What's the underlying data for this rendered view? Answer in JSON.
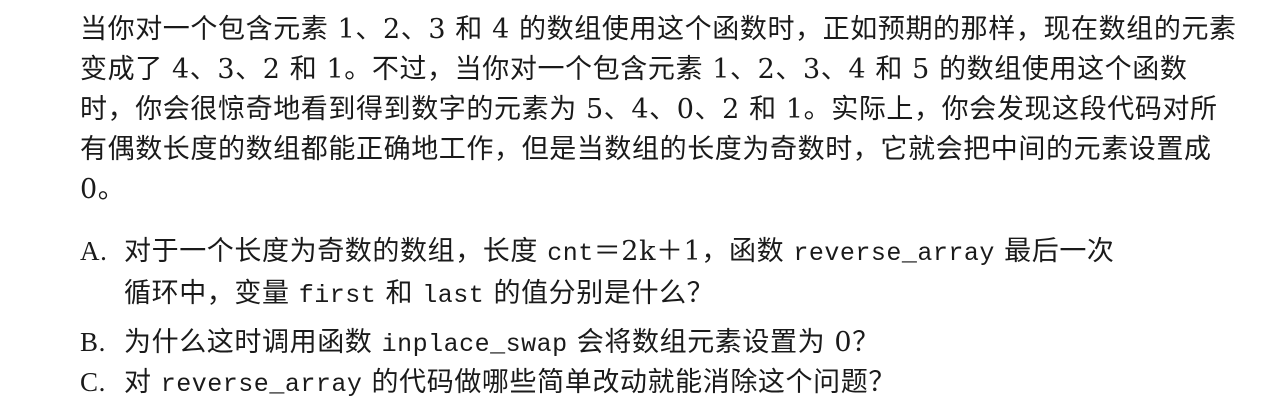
{
  "intro": "当你对一个包含元素 1、2、3 和 4 的数组使用这个函数时，正如预期的那样，现在数组的元素变成了 4、3、2 和 1。不过，当你对一个包含元素 1、2、3、4 和 5 的数组使用这个函数时，你会很惊奇地看到得到数字的元素为 5、4、0、2 和 1。实际上，你会发现这段代码对所有偶数长度的数组都能正确地工作，但是当数组的长度为奇数时，它就会把中间的元素设置成 0。",
  "questions": {
    "a": {
      "letter": "A.",
      "text1": "对于一个长度为奇数的数组，长度 ",
      "code1": "cnt",
      "text2": "＝2k＋1，函数 ",
      "code2": "reverse_array",
      "text3": " 最后一次",
      "text4": "循环中，变量 ",
      "code3": "first",
      "text5": " 和 ",
      "code4": "last",
      "text6": " 的值分别是什么？"
    },
    "b": {
      "letter": "B.",
      "text1": "为什么这时调用函数 ",
      "code1": "inplace_swap",
      "text2": " 会将数组元素设置为 0？"
    },
    "c": {
      "letter": "C.",
      "text1": "对 ",
      "code1": "reverse_array",
      "text2": " 的代码做哪些简单改动就能消除这个问题？"
    }
  }
}
